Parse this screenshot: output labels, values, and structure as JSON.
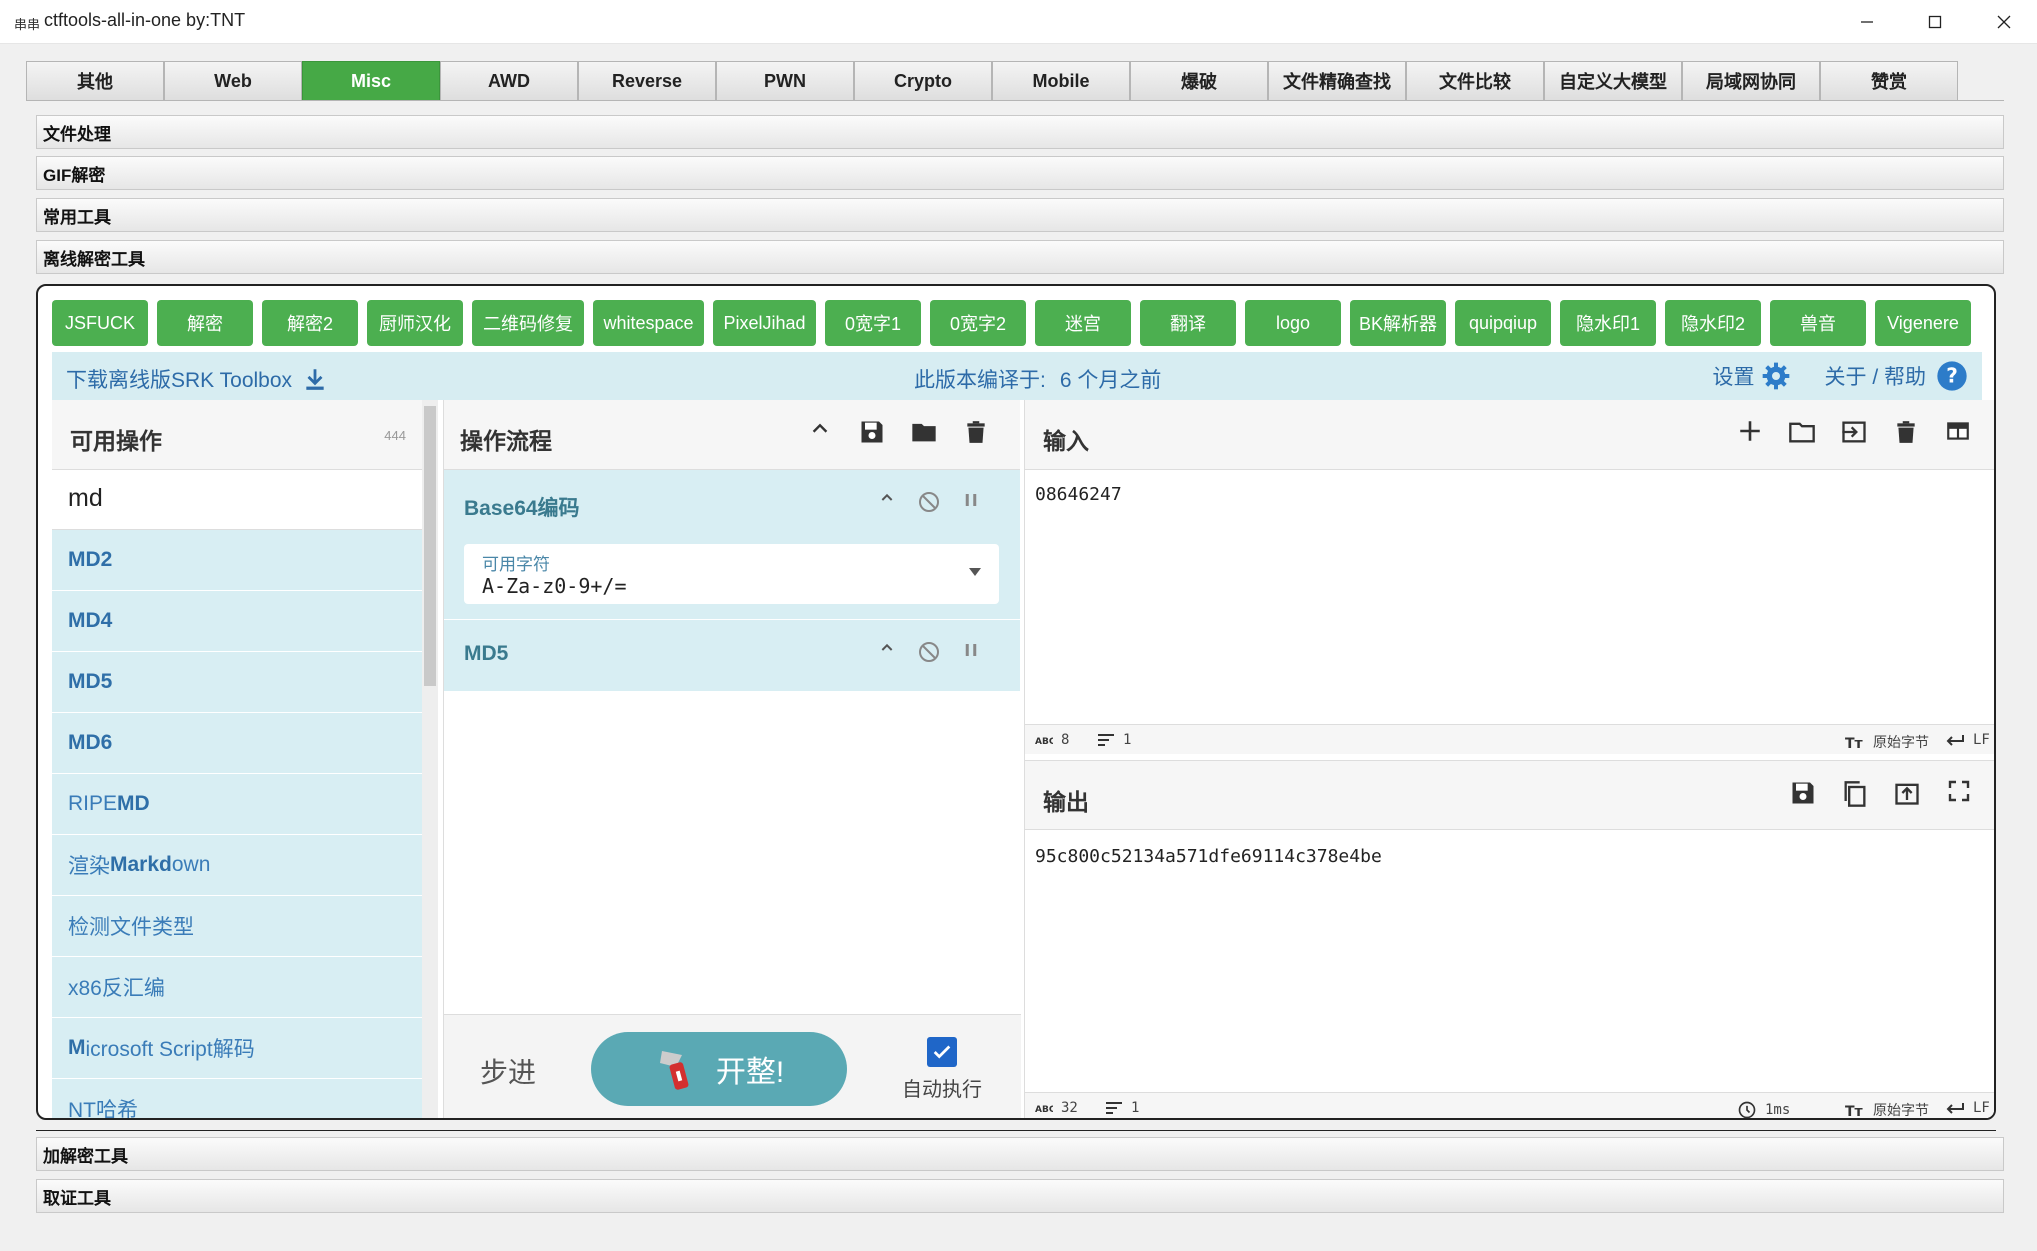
{
  "window": {
    "app_icon": "串串",
    "title": "ctftools-all-in-one   by:TNT"
  },
  "tabs": [
    "其他",
    "Web",
    "Misc",
    "AWD",
    "Reverse",
    "PWN",
    "Crypto",
    "Mobile",
    "爆破",
    "文件精确查找",
    "文件比较",
    "自定义大模型",
    "局域网协同",
    "赞赏"
  ],
  "active_tab": "Misc",
  "accordions": {
    "a1": "文件处理",
    "a2": "GIF解密",
    "a3": "常用工具",
    "a4": "离线解密工具",
    "a5": "加解密工具",
    "a6": "取证工具"
  },
  "tools": [
    "JSFUCK",
    "解密",
    "解密2",
    "厨师汉化",
    "二维码修复",
    "whitespace",
    "PixelJihad",
    "0宽字1",
    "0宽字2",
    "迷宫",
    "翻译",
    "logo",
    "BK解析器",
    "quipqiup",
    "隐水印1",
    "隐水印2",
    "兽音",
    "Vigenere"
  ],
  "infobar": {
    "download": "下载离线版SRK Toolbox",
    "version_label": "此版本编译于:",
    "version_value": "6 个月之前",
    "settings": "设置",
    "about": "关于 / 帮助"
  },
  "operations": {
    "title": "可用操作",
    "count": "444",
    "search_value": "md",
    "items": [
      {
        "pre": "",
        "hl": "MD2",
        "post": ""
      },
      {
        "pre": "",
        "hl": "MD4",
        "post": ""
      },
      {
        "pre": "",
        "hl": "MD5",
        "post": ""
      },
      {
        "pre": "",
        "hl": "MD6",
        "post": ""
      },
      {
        "pre": "RIPE",
        "hl": "MD",
        "post": ""
      },
      {
        "pre": "渲染",
        "hl": "Markd",
        "post": "own"
      },
      {
        "pre": "检测文件类型",
        "hl": "",
        "post": ""
      },
      {
        "pre": "x86反汇编",
        "hl": "",
        "post": ""
      },
      {
        "pre": "",
        "hl": "M",
        "post": "icrosoft Script解码"
      },
      {
        "pre": "NT哈希",
        "hl": "",
        "post": ""
      }
    ]
  },
  "recipe": {
    "title": "操作流程",
    "op1": {
      "name": "Base64编码",
      "arg_label": "可用字符",
      "arg_value": "A-Za-z0-9+/="
    },
    "op2": {
      "name": "MD5"
    },
    "step": "步进",
    "bake": "开整!",
    "auto": "自动执行"
  },
  "input": {
    "title": "输入",
    "value": "08646247",
    "chars": "8",
    "lines": "1",
    "encoding": "原始字节",
    "eol": "LF"
  },
  "output": {
    "title": "输出",
    "value": "95c800c52134a571dfe69114c378e4be",
    "chars": "32",
    "lines": "1",
    "time": "1ms",
    "encoding": "原始字节",
    "eol": "LF"
  },
  "colors": {
    "accent_green": "#46a946",
    "panel_blue": "#d8eef3",
    "link_blue": "#2d6ba8",
    "bake_teal": "#5aa9b4"
  },
  "icons": [
    "minimize-icon",
    "maximize-icon",
    "close-icon",
    "download-icon",
    "gear-icon",
    "help-icon",
    "chevron-up-icon",
    "save-icon",
    "folder-icon",
    "trash-icon",
    "disable-icon",
    "pause-icon",
    "caret-down-icon",
    "plus-icon",
    "import-icon",
    "layout-icon",
    "copy-icon",
    "replace-input-icon",
    "fullscreen-icon",
    "clock-icon",
    "checkbox-icon",
    "knife-icon"
  ]
}
